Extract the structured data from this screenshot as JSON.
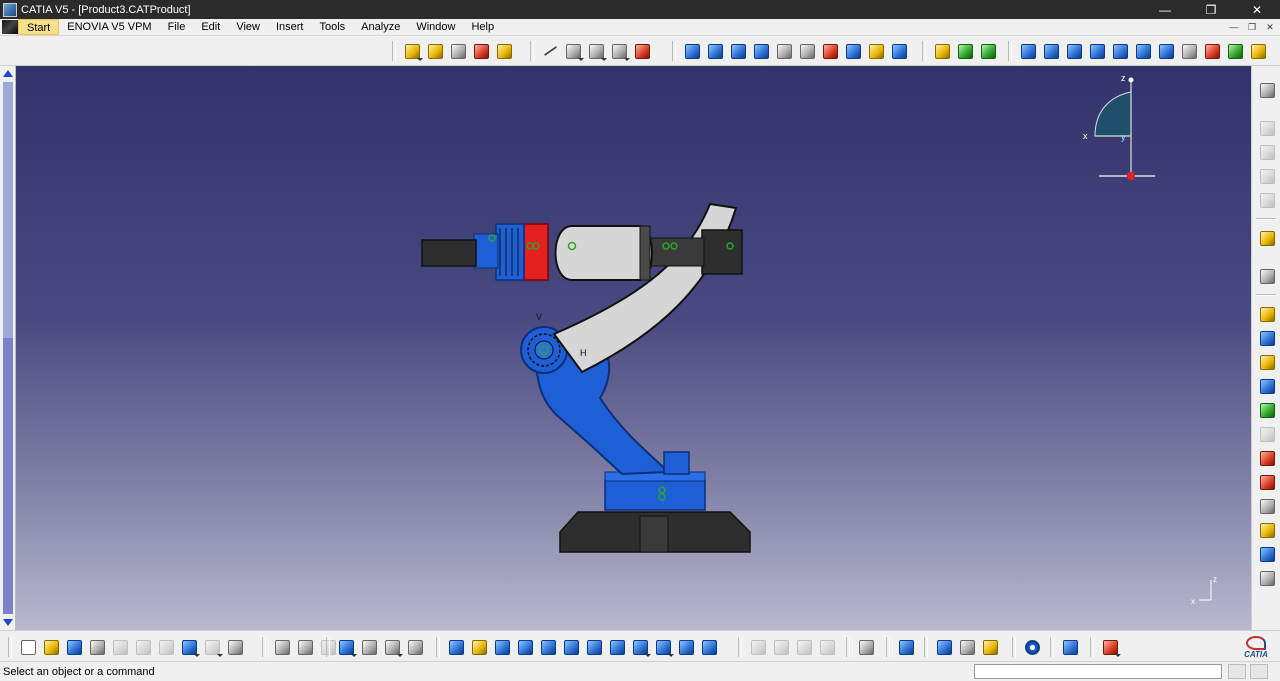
{
  "window": {
    "title": "CATIA V5 - [Product3.CATProduct]",
    "controls": [
      "minimize-icon",
      "restore-icon",
      "close-icon"
    ]
  },
  "menu": {
    "items": [
      "Start",
      "ENOVIA V5 VPM",
      "File",
      "Edit",
      "View",
      "Insert",
      "Tools",
      "Analyze",
      "Window",
      "Help"
    ]
  },
  "compass": {
    "x": "x",
    "y": "y",
    "z": "z"
  },
  "corner_axes": {
    "x": "x",
    "z": "z"
  },
  "model_labels": {
    "v": "V",
    "h": "H"
  },
  "status": {
    "message": "Select an object or a command",
    "command_input": ""
  },
  "brand": {
    "logo_text": "CATIA"
  },
  "colors": {
    "viewport_top": "#33336b",
    "viewport_bottom": "#b9b9cf",
    "robot_blue": "#1f5fd6",
    "robot_gray": "#d6d6d6",
    "robot_dark": "#2e2e2e",
    "robot_red": "#e52020",
    "start_highlight": "#f6e08a"
  }
}
